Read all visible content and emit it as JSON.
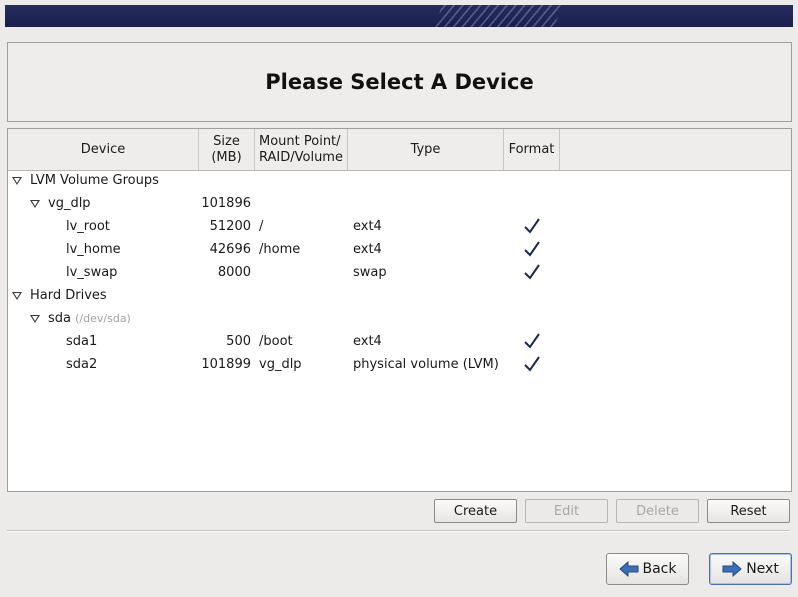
{
  "title": "Please Select A Device",
  "columns": {
    "device": "Device",
    "size_line1": "Size",
    "size_line2": "(MB)",
    "mount_line1": "Mount Point/",
    "mount_line2": "RAID/Volume",
    "type": "Type",
    "format": "Format"
  },
  "tree": {
    "lvm_group": "LVM Volume Groups",
    "vg": {
      "name": "vg_dlp",
      "size": "101896"
    },
    "lvs": [
      {
        "name": "lv_root",
        "size": "51200",
        "mount": "/",
        "type": "ext4",
        "format": true
      },
      {
        "name": "lv_home",
        "size": "42696",
        "mount": "/home",
        "type": "ext4",
        "format": true
      },
      {
        "name": "lv_swap",
        "size": "8000",
        "mount": "",
        "type": "swap",
        "format": true
      }
    ],
    "hard_drives": "Hard Drives",
    "disk": {
      "name": "sda",
      "path": "(/dev/sda)"
    },
    "parts": [
      {
        "name": "sda1",
        "size": "500",
        "mount": "/boot",
        "type": "ext4",
        "format": true
      },
      {
        "name": "sda2",
        "size": "101899",
        "mount": "vg_dlp",
        "type": "physical volume (LVM)",
        "format": true
      }
    ]
  },
  "actions": {
    "create": "Create",
    "edit": "Edit",
    "delete": "Delete",
    "reset": "Reset"
  },
  "nav": {
    "back": "Back",
    "next": "Next",
    "back_icon": "arrow-left-icon",
    "next_icon": "arrow-right-icon"
  },
  "colors": {
    "banner": "#1f2452",
    "check": "#1b2a4a",
    "arrow": "#3d6fb6"
  }
}
